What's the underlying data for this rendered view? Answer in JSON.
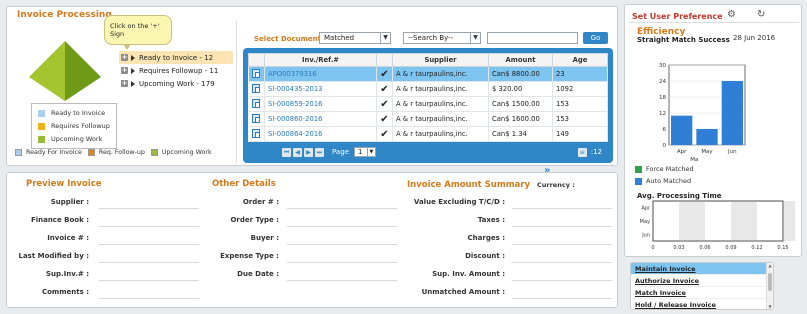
{
  "invoice_processing": {
    "title": "Invoice Processing",
    "tooltip": "Click on the '+' Sign",
    "tree": [
      {
        "label": "Ready to Invoice - 12",
        "selected": true
      },
      {
        "label": "Requires Followup - 11",
        "selected": false
      },
      {
        "label": "Upcoming Work - 179",
        "selected": false
      }
    ],
    "pyramid_legend": [
      {
        "label": "Ready to Invoice",
        "color": "#a8cfee"
      },
      {
        "label": "Requires Followup",
        "color": "#f0b21b"
      },
      {
        "label": "Upcoming Work",
        "color": "#9aba3d"
      }
    ],
    "bottom_legend": [
      {
        "label": "Ready For Invoice",
        "color": "#a8cfee"
      },
      {
        "label": "Req. Follow-up",
        "color": "#e0871d"
      },
      {
        "label": "Upcoming Work",
        "color": "#9aba3d"
      }
    ],
    "select_label": "Select Documents",
    "filter_value": "Matched",
    "search_value": "--Search By--",
    "search_text": "",
    "go_label": "Go",
    "columns": [
      "Inv./Ref.#",
      "Supplier",
      "Amount",
      "Age"
    ],
    "rows": [
      {
        "ref": "APO00379316",
        "supplier": "A & r taurpaulins,inc.",
        "amount": "Can$ 8800.00",
        "age": "23",
        "highlight": true
      },
      {
        "ref": "SI-000435-2013",
        "supplier": "A & r taurpaulins,inc.",
        "amount": "$ 320.00",
        "age": "1092",
        "highlight": false
      },
      {
        "ref": "SI-000859-2016",
        "supplier": "A & r taurpaulins,inc.",
        "amount": "Can$ 1500.00",
        "age": "153",
        "highlight": false
      },
      {
        "ref": "SI-000860-2016",
        "supplier": "A & r taurpaulins,inc.",
        "amount": "Can$ 1600.00",
        "age": "153",
        "highlight": false
      },
      {
        "ref": "SI-000864-2016",
        "supplier": "A & r taurpaulins,inc.",
        "amount": "Can$ 1.34",
        "age": "149",
        "highlight": false
      }
    ],
    "pager": {
      "label": "Page",
      "page": "1",
      "total": "12"
    }
  },
  "details": {
    "preview_title": "Preview Invoice",
    "other_title": "Other Details",
    "summary_title": "Invoice Amount Summary",
    "currency_label": "Currency :",
    "preview_fields": [
      "Supplier :",
      "Finance Book :",
      "Invoice # :",
      "Last Modified by :",
      "Sup.Inv.# :",
      "Comments :"
    ],
    "other_fields": [
      "Order # :",
      "Order Type :",
      "Buyer :",
      "Expense Type :",
      "Due Date :"
    ],
    "summary_fields": [
      "Value Excluding T/C/D :",
      "Taxes :",
      "Charges :",
      "Discount :",
      "Sup. Inv. Amount :",
      "Unmatched Amount :"
    ]
  },
  "right_panel": {
    "pref_label": "Set User Preference",
    "efficiency_title": "Efficiency",
    "efficiency_subtitle": "Straight Match Success",
    "date": "28 Jun 2016",
    "legend": [
      {
        "label": "Force Matched",
        "color": "#2ea34a"
      },
      {
        "label": "Auto Matched",
        "color": "#2f7fd6"
      }
    ],
    "avg_title": "Avg. Processing Time",
    "menu": [
      {
        "label": "Maintain Invoice",
        "active": true
      },
      {
        "label": "Authorize Invoice",
        "active": false
      },
      {
        "label": "Match Invoice",
        "active": false
      },
      {
        "label": "Hold / Release Invoice",
        "active": false
      }
    ]
  },
  "chart_data": [
    {
      "type": "bar",
      "title": "Straight Match Success",
      "categories": [
        "Apr",
        "May",
        "Jun"
      ],
      "xlabel_extra": "Ma",
      "series": [
        {
          "name": "Auto Matched",
          "values": [
            11,
            6,
            24
          ]
        }
      ],
      "ylim": [
        0,
        30
      ],
      "yticks": [
        "0",
        "6",
        "12",
        "18",
        "24",
        "30"
      ]
    },
    {
      "type": "bar",
      "title": "Avg. Processing Time",
      "categories": [
        "Apr",
        "May",
        "Jun"
      ],
      "values": [
        0,
        0,
        0
      ],
      "xlim": [
        0,
        0.15
      ],
      "xticks": [
        "0",
        "0.03",
        "0.06",
        "0.09",
        "0.12",
        "0.15"
      ]
    }
  ]
}
